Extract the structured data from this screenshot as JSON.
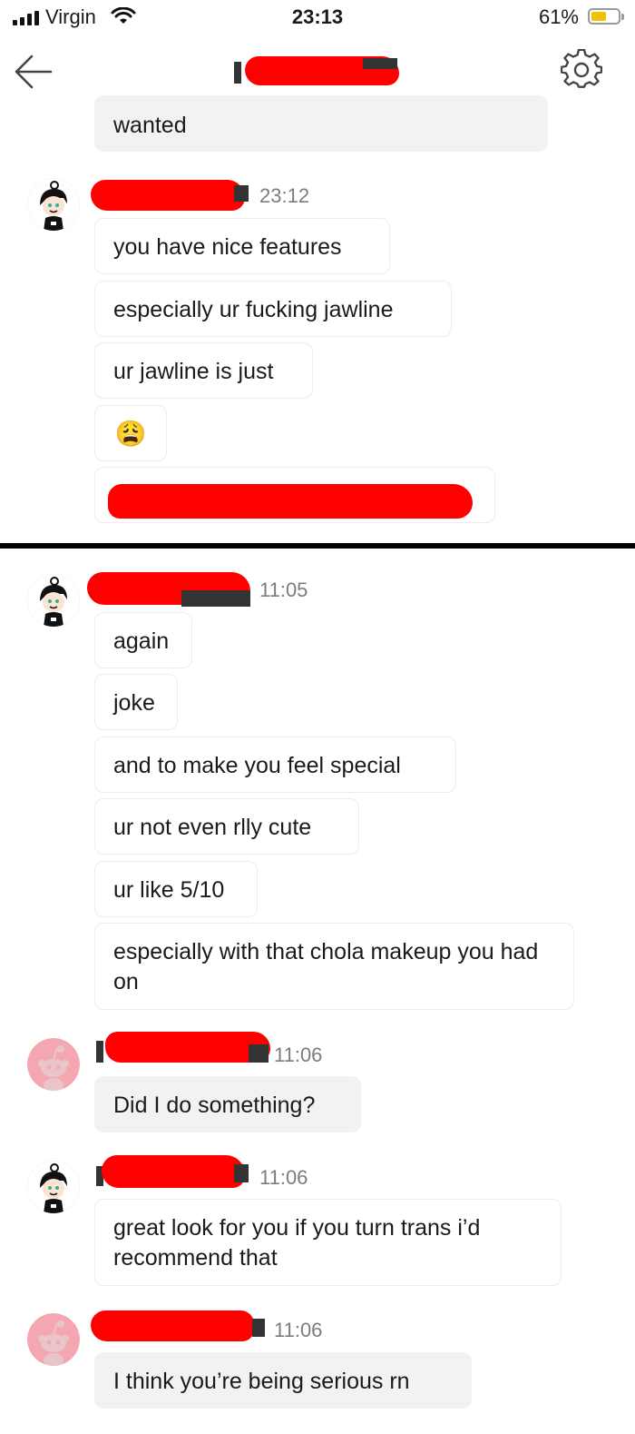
{
  "status_bar": {
    "carrier": "Virgin",
    "time": "23:13",
    "battery_percent": "61%",
    "battery_level": 0.61
  },
  "header": {
    "title_redacted": true,
    "back_icon": "back-arrow-icon",
    "settings_icon": "gear-icon"
  },
  "screenshot_one": {
    "top_message": "wanted",
    "group": {
      "sender_avatar": "cartoon-girl-avatar",
      "time": "23:12",
      "messages": [
        "you have nice features",
        "especially ur fucking jawline",
        "ur jawline is just",
        "😩"
      ]
    }
  },
  "screenshot_two": {
    "groups": [
      {
        "sender_avatar": "cartoon-girl-avatar",
        "time": "11:05",
        "messages": [
          "again",
          "joke",
          "and to make you feel special",
          "ur not even rlly cute",
          "ur like 5/10",
          "especially with that chola makeup you had on"
        ]
      },
      {
        "sender_avatar": "reddit-snoo-avatar",
        "time": "11:06",
        "messages": [
          "Did I do something?"
        ]
      },
      {
        "sender_avatar": "cartoon-girl-avatar",
        "time": "11:06",
        "messages": [
          "great look for you if you turn trans i’d recommend that"
        ]
      },
      {
        "sender_avatar": "reddit-snoo-avatar",
        "time": "11:06",
        "messages": [
          "I think you’re being serious rn"
        ]
      }
    ]
  },
  "colors": {
    "redaction": "#ff0000",
    "own_bubble": "#f1f2f4",
    "other_bubble_border": "#ececec",
    "snoo_avatar_bg": "#f4a7b0"
  }
}
